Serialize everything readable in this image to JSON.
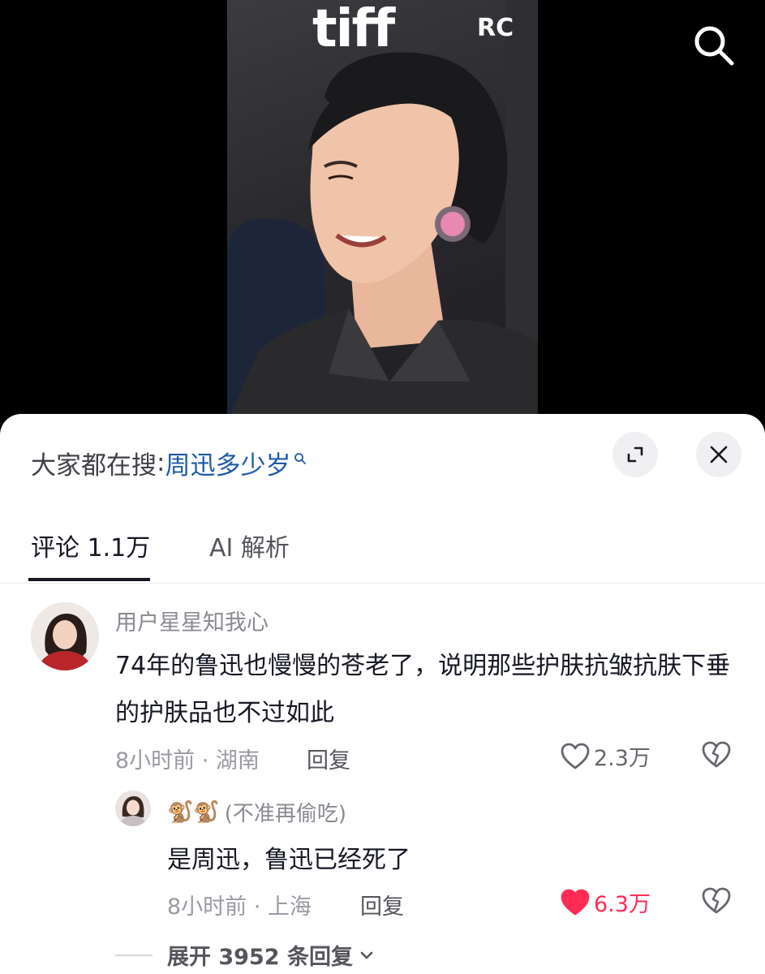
{
  "video": {
    "backdrop_brand": "tiff",
    "backdrop_partner": "RC"
  },
  "hot_search": {
    "prefix": "大家都在搜",
    "colon": ":",
    "term": "周迅多少岁"
  },
  "tabs": [
    {
      "label": "评论 1.1万",
      "active": true
    },
    {
      "label": "AI 解析",
      "active": false
    }
  ],
  "comment": {
    "username": "用户星星知我心",
    "text": "74年的鲁迅也慢慢的苍老了，说明那些护肤抗皱抗肤下垂的护肤品也不过如此",
    "meta": "8小时前 · 湖南",
    "reply_label": "回复",
    "likes": "2.3万",
    "liked": false
  },
  "reply": {
    "username": "(不准再偷吃)",
    "emoji": "🐒🐒",
    "text": "是周迅，鲁迅已经死了",
    "meta": "8小时前 · 上海",
    "reply_label": "回复",
    "likes": "6.3万",
    "liked": true
  },
  "expand": {
    "label": "展开 3952 条回复"
  },
  "colors": {
    "accent_like": "#fe2c55",
    "link_blue": "#1f5aa8",
    "text_primary": "#161823",
    "text_secondary": "#8a8a92"
  },
  "icons": [
    "search-icon",
    "expand-icon",
    "close-icon",
    "heart-icon",
    "dislike-icon",
    "chevron-down-icon"
  ]
}
